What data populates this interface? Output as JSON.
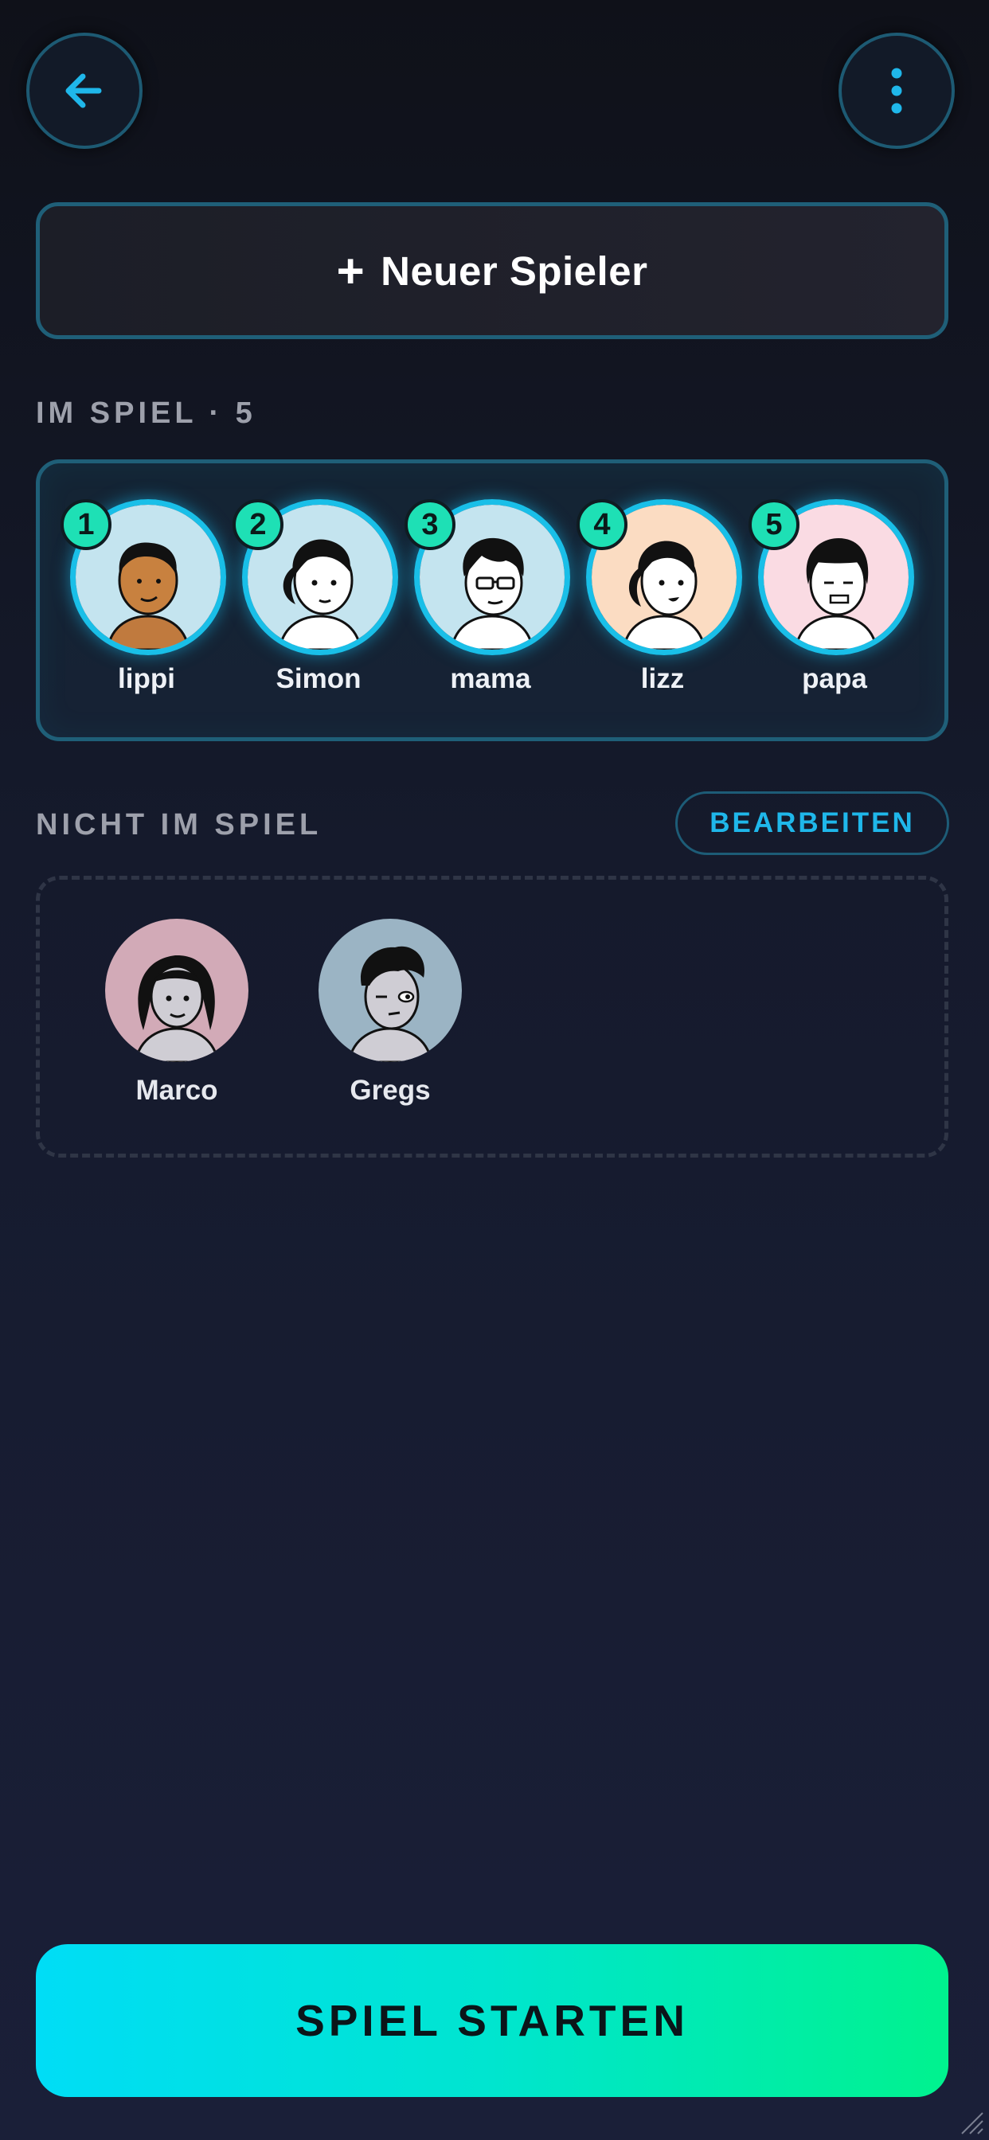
{
  "header": {
    "back_icon": "arrow-left-icon",
    "menu_icon": "vertical-dots-icon"
  },
  "new_player": {
    "plus": "+",
    "label": "Neuer Spieler"
  },
  "in_game": {
    "label": "IM SPIEL · 5",
    "players": [
      {
        "number": "1",
        "name": "lippi",
        "bg": "#c4e4ef"
      },
      {
        "number": "2",
        "name": "Simon",
        "bg": "#c4e4ef"
      },
      {
        "number": "3",
        "name": "mama",
        "bg": "#c4e4ef"
      },
      {
        "number": "4",
        "name": "lizz",
        "bg": "#fbdcc2"
      },
      {
        "number": "5",
        "name": "papa",
        "bg": "#fadbe3"
      }
    ]
  },
  "not_in_game": {
    "label": "NICHT IM SPIEL",
    "edit_label": "BEARBEITEN",
    "players": [
      {
        "name": "Marco",
        "bg": "#d2aab7"
      },
      {
        "name": "Gregs",
        "bg": "#9bb4c4"
      }
    ]
  },
  "start_label": "SPIEL STARTEN",
  "colors": {
    "accent_cyan": "#19bfe8",
    "badge_green": "#1ee0b5",
    "gradient_start": "#00ddf6",
    "gradient_end": "#00f28e"
  }
}
